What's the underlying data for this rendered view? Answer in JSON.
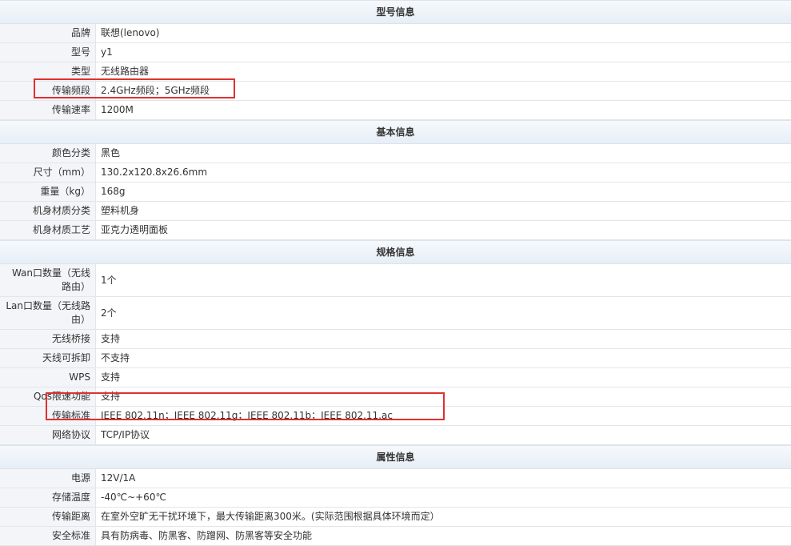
{
  "sections": [
    {
      "title": "型号信息",
      "rows": [
        {
          "label": "品牌",
          "value": "联想(lenovo)"
        },
        {
          "label": "型号",
          "value": "y1"
        },
        {
          "label": "类型",
          "value": "无线路由器"
        },
        {
          "label": "传输频段",
          "value": "2.4GHz频段；5GHz频段"
        },
        {
          "label": "传输速率",
          "value": "1200M"
        }
      ]
    },
    {
      "title": "基本信息",
      "rows": [
        {
          "label": "颜色分类",
          "value": "黑色"
        },
        {
          "label": "尺寸（mm）",
          "value": "130.2x120.8x26.6mm"
        },
        {
          "label": "重量（kg）",
          "value": "168g"
        },
        {
          "label": "机身材质分类",
          "value": "塑料机身"
        },
        {
          "label": "机身材质工艺",
          "value": "亚克力透明面板"
        }
      ]
    },
    {
      "title": "规格信息",
      "rows": [
        {
          "label": "Wan口数量（无线路由）",
          "value": "1个"
        },
        {
          "label": "Lan口数量（无线路由）",
          "value": "2个"
        },
        {
          "label": "无线桥接",
          "value": "支持"
        },
        {
          "label": "天线可拆卸",
          "value": "不支持"
        },
        {
          "label": "WPS",
          "value": "支持"
        },
        {
          "label": "Qos限速功能",
          "value": "支持"
        },
        {
          "label": "传输标准",
          "value": "IEEE 802.11n；IEEE 802.11g；IEEE 802.11b；IEEE 802.11.ac"
        },
        {
          "label": "网络协议",
          "value": "TCP/IP协议"
        }
      ]
    },
    {
      "title": "属性信息",
      "rows": [
        {
          "label": "电源",
          "value": "12V/1A"
        },
        {
          "label": "存储温度",
          "value": "-40℃~+60℃"
        },
        {
          "label": "传输距离",
          "value": "在室外空旷无干扰环境下，最大传输距离300米。(实际范围根据具体环境而定）"
        },
        {
          "label": "安全标准",
          "value": "具有防病毒、防黑客、防蹭网、防黑客等安全功能"
        }
      ]
    }
  ],
  "highlight_color": "#e03030"
}
